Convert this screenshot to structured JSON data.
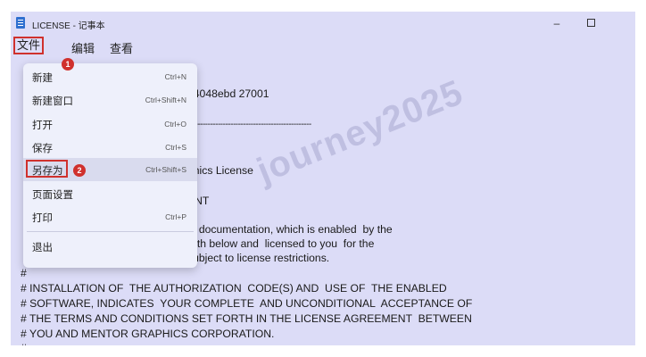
{
  "window": {
    "title": "LICENSE - 记事本",
    "minimize_glyph": "–",
    "icon": "notepad-icon"
  },
  "menubar": {
    "file": "文件",
    "edit": "编辑",
    "view": "查看"
  },
  "badges": {
    "step1": "1",
    "step2": "2"
  },
  "file_menu": {
    "items": [
      {
        "label": "新建",
        "shortcut": "Ctrl+N"
      },
      {
        "label": "新建窗口",
        "shortcut": "Ctrl+Shift+N"
      },
      {
        "label": "打开",
        "shortcut": "Ctrl+O"
      },
      {
        "label": "保存",
        "shortcut": "Ctrl+S"
      },
      {
        "label": "另存为",
        "shortcut": "Ctrl+Shift+S"
      },
      {
        "label": "页面设置",
        "shortcut": ""
      },
      {
        "label": "打印",
        "shortcut": "Ctrl+P"
      },
      {
        "label": "退出",
        "shortcut": ""
      }
    ]
  },
  "editor": {
    "lines": [
      "34048ebd 27001",
      "-------------------------------------------------",
      "phics License",
      "ANT",
      "y  documentation, which is enabled  by the",
      "orth below and  licensed to you  for the",
      "subject to license restrictions.",
      "#",
      "# INSTALLATION OF  THE AUTHORIZATION  CODE(S) AND  USE OF  THE ENABLED",
      "# SOFTWARE, INDICATES  YOUR COMPLETE  AND UNCONDITIONAL  ACCEPTANCE OF",
      "# THE TERMS AND CONDITIONS SET FORTH IN THE LICENSE AGREEMENT  BETWEEN",
      "# YOU AND MENTOR GRAPHICS CORPORATION.",
      "#"
    ]
  },
  "watermark": "journey2025",
  "colors": {
    "accent_red": "#d0312d",
    "window_bg": "#dcdcf7",
    "menu_bg": "#eef0fb"
  }
}
